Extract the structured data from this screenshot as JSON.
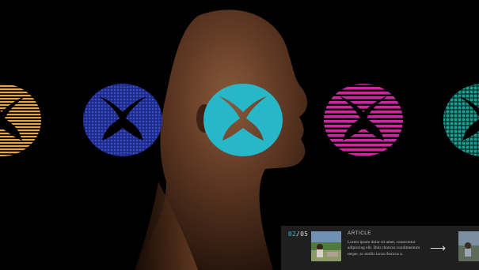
{
  "colors": {
    "logo_orange": "#e4a54a",
    "logo_blue": "#2d3fae",
    "logo_cyan": "#27b7c9",
    "logo_magenta": "#c52aa0",
    "logo_teal": "#178c80",
    "counter_accent": "#2fb8d2"
  },
  "hero": {
    "logos": [
      {
        "name": "logo-orange-striped",
        "pattern": "horizontal-stripes",
        "color": "#e4a54a"
      },
      {
        "name": "logo-blue-dotted",
        "pattern": "dots",
        "color": "#2d3fae"
      },
      {
        "name": "logo-cyan-solid",
        "pattern": "solid",
        "color": "#27b7c9"
      },
      {
        "name": "logo-magenta-striped",
        "pattern": "horizontal-stripes",
        "color": "#c52aa0"
      },
      {
        "name": "logo-teal-dotted",
        "pattern": "dots",
        "color": "#178c80"
      }
    ]
  },
  "article_card": {
    "counter_current": "02",
    "counter_total": "/05",
    "kicker": "ARTICLE",
    "excerpt": "Lorem ipsum dolor sit amet, consectetur adipiscing elit. Duis rhoncus condimentum neque, ac mollis lacus rhoncus a.",
    "arrow": "⟶"
  }
}
